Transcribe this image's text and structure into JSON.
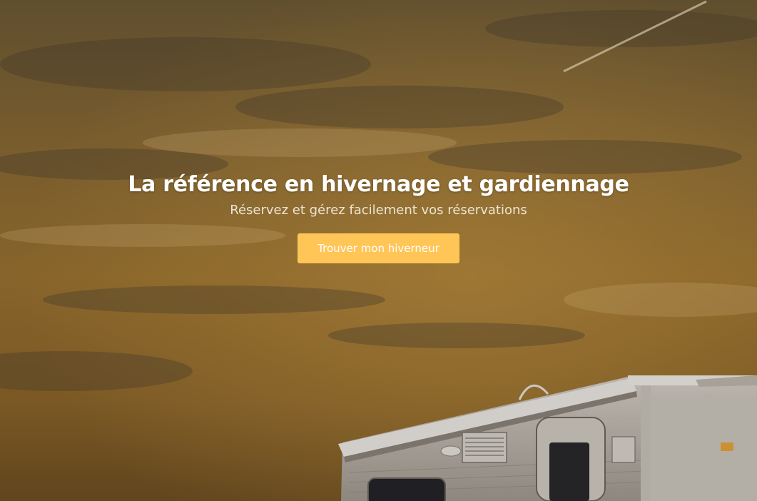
{
  "hero": {
    "title": "La référence en hivernage et gardiennage",
    "subtitle": "Réservez et gérez facilement vos réservations",
    "cta_label": "Trouver mon hiverneur",
    "accent_color": "#ffc557",
    "overlay_tint": "#8a6a34"
  },
  "background": {
    "subject": "camper-trailer-under-sunset-sky"
  }
}
